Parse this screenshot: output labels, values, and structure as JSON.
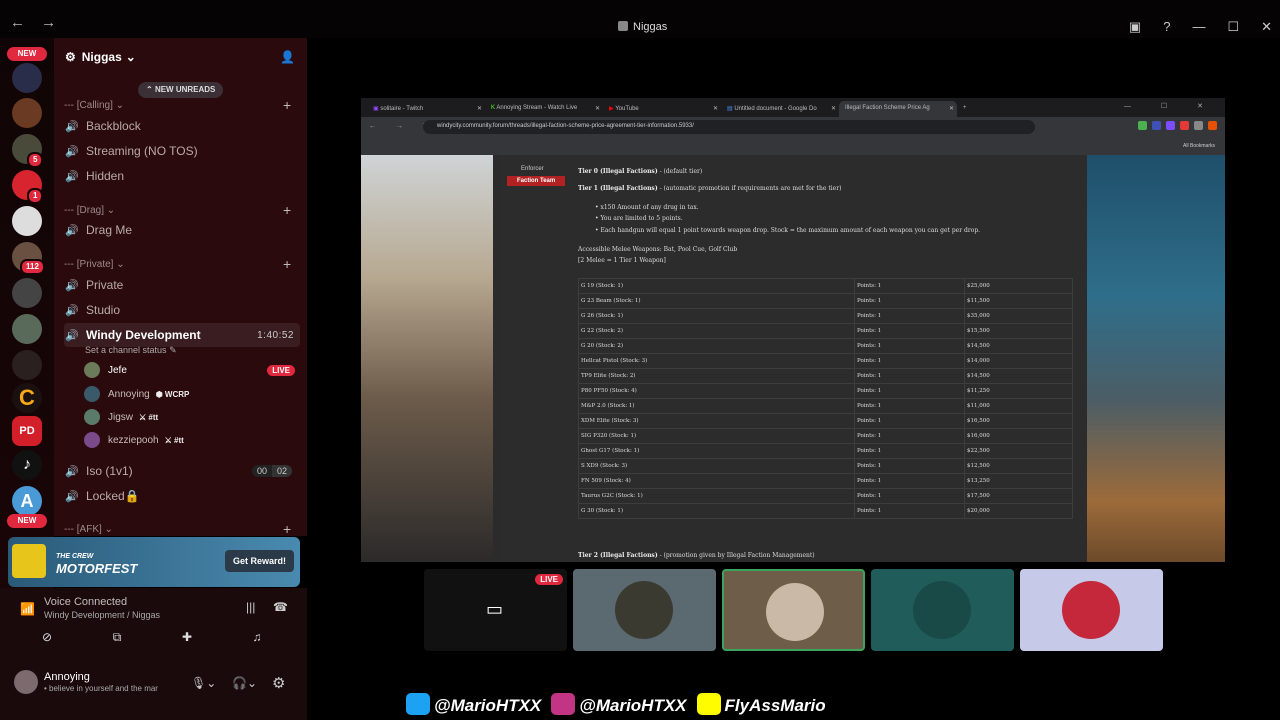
{
  "window": {
    "title": "Niggas",
    "nav": "← →"
  },
  "server": {
    "name": "Niggas",
    "new_unreads": "NEW UNREADS"
  },
  "rail": {
    "new_top": "NEW",
    "new_bottom": "NEW",
    "badges": [
      "5",
      "1",
      "112"
    ]
  },
  "categories": [
    {
      "label": "--- [Calling]"
    },
    {
      "label": "--- [Drag]"
    },
    {
      "label": "--- [Private]"
    },
    {
      "label": "--- [AFK]"
    }
  ],
  "channels": {
    "backblock": "Backblock",
    "streaming": "Streaming (NO TOS)",
    "hidden": "Hidden",
    "dragme": "Drag Me",
    "private": "Private",
    "studio": "Studio",
    "windy": "Windy Development",
    "windy_time": "1:40:52",
    "set_status": "Set a channel status",
    "iso": "Iso (1v1)",
    "iso_counts": [
      "00",
      "02"
    ],
    "locked": "Locked🔒"
  },
  "members": [
    {
      "name": "Jefe",
      "tag": "",
      "live": "LIVE"
    },
    {
      "name": "Annoying",
      "tag": "WCRP"
    },
    {
      "name": "Jigsw",
      "tag": "#tt"
    },
    {
      "name": "kezziepooh",
      "tag": "#tt"
    }
  ],
  "promo": {
    "brand_small": "THE CREW",
    "brand": "MOTORFEST",
    "cta": "Get Reward!"
  },
  "voice": {
    "connected": "Voice Connected",
    "channel": "Windy Development / Niggas"
  },
  "user": {
    "name": "Annoying",
    "status": "• believe in yourself and the mar"
  },
  "browser": {
    "tabs": [
      "solitaire - Twitch",
      "Annoying Stream - Watch Live",
      "YouTube",
      "Untitled document - Google Do",
      "Illegal Faction Scheme Price Ag"
    ],
    "url": "windycity.community.forum/threads/illegal-faction-scheme-price-agreement-tier-information.5933/",
    "all_bookmarks": "All Bookmarks"
  },
  "forum": {
    "side_enforcer": "Enforcer",
    "side_faction": "Faction Team",
    "tier0": "Tier 0 (Illegal Factions)",
    "tier0_note": " - (default tier)",
    "tier1": "Tier 1 (Illegal Factions)",
    "tier1_note": " - (automatic promotion if requirements are met for the tier)",
    "bullets": [
      "x150 Amount of any drug in tax.",
      "You are limited to 5 points.",
      "Each handgun will equal 1 point towards weapon drop. Stock = the maximum amount of each weapon you can get per drop."
    ],
    "melee": "Accessible Melee Weapons: Bat, Pool Cue, Golf Club",
    "melee_rule": "[2 Melee = 1 Tier 1 Weapon]",
    "tier2": "Tier 2 (Illegal Factions)",
    "tier2_note": " - (promotion given by Illegal Faction Management)",
    "rows": [
      [
        "G 19 (Stock: 1)",
        "Points: 1",
        "$25,000"
      ],
      [
        "G 23 Beam (Stock: 1)",
        "Points: 1",
        "$11,500"
      ],
      [
        "G 26 (Stock: 1)",
        "Points: 1",
        "$35,000"
      ],
      [
        "G 22 (Stock: 2)",
        "Points: 1",
        "$15,500"
      ],
      [
        "G 20 (Stock: 2)",
        "Points: 1",
        "$14,500"
      ],
      [
        "Hellcat Pistol (Stock: 3)",
        "Points: 1",
        "$14,000"
      ],
      [
        "TP9 Elite (Stock: 2)",
        "Points: 1",
        "$14,500"
      ],
      [
        "P80 PF50 (Stock: 4)",
        "Points: 1",
        "$11,250"
      ],
      [
        "M&P 2.0 (Stock: 1)",
        "Points: 1",
        "$11,000"
      ],
      [
        "XDM Elite (Stock: 3)",
        "Points: 1",
        "$16,500"
      ],
      [
        "SIG P320 (Stock: 1)",
        "Points: 1",
        "$16,000"
      ],
      [
        "Ghost G17 (Stock: 1)",
        "Points: 1",
        "$22,500"
      ],
      [
        "S XD9 (Stock: 3)",
        "Points: 1",
        "$12,500"
      ],
      [
        "FN 509 (Stock: 4)",
        "Points: 1",
        "$13,250"
      ],
      [
        "Taurus G2C (Stock: 1)",
        "Points: 1",
        "$17,500"
      ],
      [
        "G 30 (Stock: 1)",
        "Points: 1",
        "$20,000"
      ]
    ]
  },
  "tiles": {
    "live": "LIVE"
  },
  "socials": [
    "@MarioHTXX",
    "@MarioHTXX",
    "FlyAssMario"
  ]
}
